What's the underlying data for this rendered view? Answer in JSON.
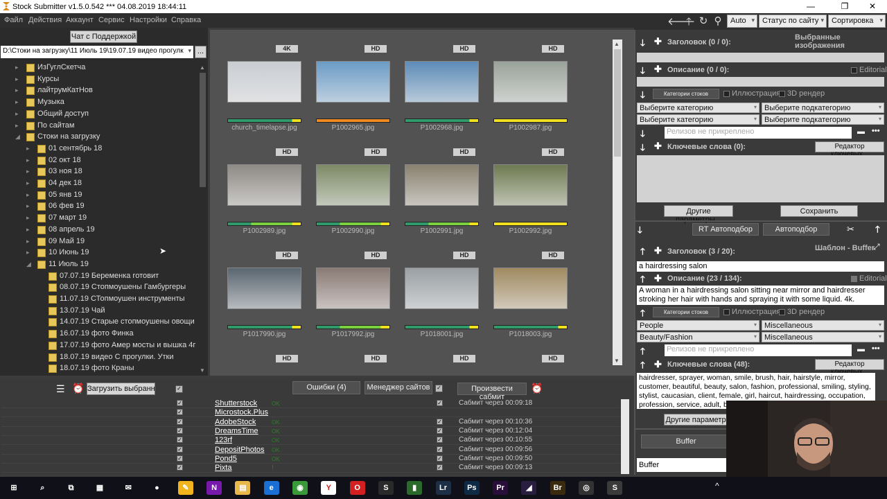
{
  "window": {
    "title": "Stock Submitter v1.5.0.542 ***  04.08.2019 18:44:11"
  },
  "menu": [
    "Файл",
    "Действия",
    "Аккаунт",
    "Сервис",
    "Настройки",
    "Справка"
  ],
  "toolbar": {
    "zoom": "Auto",
    "status_filter": "Статус по сайту",
    "sort": "Сортировка"
  },
  "left": {
    "support_button": "Чат с Поддержкой",
    "path": "D:\\Стоки на загрузку\\11 Июль 19\\19.07.19 видео прогулк",
    "browse_button": "...",
    "tree": [
      {
        "label": "ИзГуглСкетча",
        "level": 0,
        "exp": "▸"
      },
      {
        "label": "Курсы",
        "level": 0,
        "exp": "▸"
      },
      {
        "label": "лайтрумКатНов",
        "level": 0,
        "exp": "▸"
      },
      {
        "label": "Музыка",
        "level": 0,
        "exp": "▸"
      },
      {
        "label": "Общий доступ",
        "level": 0,
        "exp": "▸"
      },
      {
        "label": "По сайтам",
        "level": 0,
        "exp": "▸"
      },
      {
        "label": "Стоки на загрузку",
        "level": 0,
        "exp": "◢"
      },
      {
        "label": "01 сентябрь 18",
        "level": 1,
        "exp": "▸"
      },
      {
        "label": "02 окт 18",
        "level": 1,
        "exp": "▸"
      },
      {
        "label": "03 ноя 18",
        "level": 1,
        "exp": "▸"
      },
      {
        "label": "04 дек 18",
        "level": 1,
        "exp": "▸"
      },
      {
        "label": "05 янв 19",
        "level": 1,
        "exp": "▸"
      },
      {
        "label": "06 фев 19",
        "level": 1,
        "exp": "▸"
      },
      {
        "label": "07 март 19",
        "level": 1,
        "exp": "▸"
      },
      {
        "label": "08 апрель 19",
        "level": 1,
        "exp": "▸"
      },
      {
        "label": "09 Май 19",
        "level": 1,
        "exp": "▸"
      },
      {
        "label": "10 Июнь 19",
        "level": 1,
        "exp": "▸"
      },
      {
        "label": "11 Июль 19",
        "level": 1,
        "exp": "◢"
      },
      {
        "label": "07.07.19 Беременка готовит",
        "level": 2,
        "exp": ""
      },
      {
        "label": "08.07.19 Стопмоушены Гамбургеры",
        "level": 2,
        "exp": ""
      },
      {
        "label": "11.07.19 СТопмоушен инструменты",
        "level": 2,
        "exp": ""
      },
      {
        "label": "13.07.19 Чай",
        "level": 2,
        "exp": ""
      },
      {
        "label": "14.07.19 Старые стопмоушены овощи",
        "level": 2,
        "exp": ""
      },
      {
        "label": "16.07.19 фото Финка",
        "level": 2,
        "exp": ""
      },
      {
        "label": "17.07.19 фото Амер мосты и вышка 4г",
        "level": 2,
        "exp": ""
      },
      {
        "label": "18.07.19 видео С прогулки. Утки",
        "level": 2,
        "exp": ""
      },
      {
        "label": "18.07.19 фото Краны",
        "level": 2,
        "exp": ""
      }
    ]
  },
  "grid": {
    "items": [
      {
        "badge": "4K",
        "name": "church_timelapse.jpg",
        "bar": "gy",
        "img": "#c9cdd2"
      },
      {
        "badge": "HD",
        "name": "P1002965.jpg",
        "bar": "o",
        "img": "#6b9cc6"
      },
      {
        "badge": "HD",
        "name": "P1002968.jpg",
        "bar": "gy",
        "img": "#5d8cb8"
      },
      {
        "badge": "HD",
        "name": "P1002987.jpg",
        "bar": "y",
        "img": "#9aa39a"
      },
      {
        "badge": "HD",
        "name": "P1002989.jpg",
        "bar": "gly",
        "img": "#8e8a84"
      },
      {
        "badge": "HD",
        "name": "P1002990.jpg",
        "bar": "gly",
        "img": "#7c8a66"
      },
      {
        "badge": "HD",
        "name": "P1002991.jpg",
        "bar": "gly",
        "img": "#8a8270"
      },
      {
        "badge": "HD",
        "name": "P1002992.jpg",
        "bar": "y",
        "img": "#6e7a50"
      },
      {
        "badge": "HD",
        "name": "P1017990.jpg",
        "bar": "gy",
        "img": "#5a6670"
      },
      {
        "badge": "HD",
        "name": "P1017992.jpg",
        "bar": "gly",
        "img": "#8a7a74"
      },
      {
        "badge": "HD",
        "name": "P1018001.jpg",
        "bar": "gy",
        "img": "#9aa0a4"
      },
      {
        "badge": "HD",
        "name": "P1018003.jpg",
        "bar": "gy",
        "img": "#a08a60"
      },
      {
        "badge": "HD",
        "name": "",
        "bar": "",
        "img": ""
      },
      {
        "badge": "HD",
        "name": "",
        "bar": "",
        "img": ""
      },
      {
        "badge": "HD",
        "name": "",
        "bar": "",
        "img": ""
      },
      {
        "badge": "HD",
        "name": "",
        "bar": "",
        "img": ""
      }
    ]
  },
  "selected": {
    "header": "Выбранные изображения",
    "title_label": "Заголовок (0 / 0):",
    "desc_label": "Описание (0 / 0):",
    "editorial": "Editorial",
    "categories_btn": "Категории стоков",
    "illustration": "Иллюстрация",
    "render3d": "3D рендер",
    "cat1": "Выберите категорию",
    "subcat1": "Выберите подкатегорию",
    "cat2": "Выберите категорию",
    "subcat2": "Выберите подкатегорию",
    "release_placeholder": "Релизов не прикреплено",
    "keywords_label": "Ключевые слова (0):",
    "kw_editor": "Редактор ключевых...",
    "other_params": "Другие параметры...",
    "save": "Сохранить",
    "rt_auto": "RT Автоподбор",
    "auto": "Автоподбор"
  },
  "template": {
    "title_label": "Заголовок (3 / 20):",
    "template_name": "Шаблон - Buffer",
    "title_value": "a hairdressing salon",
    "desc_label": "Описание (23 / 134):",
    "editorial": "Editorial",
    "desc_value": "A woman in a hairdressing salon sitting near mirror and hairdresser stroking her hair with hands and spraying it with some liquid. 4k.",
    "categories_btn": "Категории стоков",
    "illustration": "Иллюстрация",
    "render3d": "3D рендер",
    "cat1": "People",
    "subcat1": "Miscellaneous",
    "cat2": "Beauty/Fashion",
    "subcat2": "Miscellaneous",
    "release_placeholder": "Релизов не прикреплено",
    "keywords_label": "Ключевые слова (48):",
    "kw_editor": "Редактор ключевых...",
    "keywords": "hairdresser, sprayer, woman, smile, brush, hair, hairstyle, mirror, customer, beautiful, beauty, salon, fashion, professional, smiling, styling, stylist, caucasian, client, female, girl, haircut, hairdressing, occupation, profession, service, adult, barber, care, fashionable, hairstylist, head, people, pretty,",
    "other_params": "Другие параметры",
    "buffer_btn": "Buffer",
    "buffer_value": "Buffer"
  },
  "bottom": {
    "upload_selected": "Загрузить выбранное",
    "errors": "Ошибки (4)",
    "site_manager": "Менеджер сайтов",
    "submit": "Произвести сабмит",
    "sites": [
      {
        "name": "Shutterstock",
        "ok": "OK",
        "status": "Сабмит через 00:09:18"
      },
      {
        "name": "Microstock.Plus",
        "ok": "",
        "status": ""
      },
      {
        "name": "AdobeStock",
        "ok": "OK",
        "status": "Сабмит через 00:10:36"
      },
      {
        "name": "DreamsTime",
        "ok": "OK",
        "status": "Сабмит через 00:12:04"
      },
      {
        "name": "123rf",
        "ok": "OK",
        "status": "Сабмит через 00:10:55"
      },
      {
        "name": "DepositPhotos",
        "ok": "OK",
        "status": "Сабмит через 00:09:56"
      },
      {
        "name": "Pond5",
        "ok": "OK",
        "status": "Сабмит через 00:09:50"
      },
      {
        "name": "Pixta",
        "ok": "!",
        "status": "Сабмит через 00:09:13"
      }
    ]
  },
  "taskbar": {
    "apps": [
      {
        "name": "windows-start",
        "label": "⊞",
        "color": "#101018"
      },
      {
        "name": "search",
        "label": "⌕",
        "color": "#101018"
      },
      {
        "name": "task-view",
        "label": "⧉",
        "color": "#101018"
      },
      {
        "name": "calendar",
        "label": "▦",
        "color": "#101018"
      },
      {
        "name": "mail",
        "label": "✉",
        "color": "#101018"
      },
      {
        "name": "recorder",
        "label": "●",
        "color": "#101018"
      },
      {
        "name": "notes",
        "label": "✎",
        "color": "#f1b41c"
      },
      {
        "name": "onenote",
        "label": "N",
        "color": "#7719aa"
      },
      {
        "name": "explorer",
        "label": "▤",
        "color": "#e8b84a"
      },
      {
        "name": "edge",
        "label": "e",
        "color": "#1a6fd4"
      },
      {
        "name": "chrome",
        "label": "◉",
        "color": "#3a9a3a"
      },
      {
        "name": "yandex",
        "label": "Y",
        "color": "#fff"
      },
      {
        "name": "opera",
        "label": "O",
        "color": "#d21f1f"
      },
      {
        "name": "stocksubmitter",
        "label": "S",
        "color": "#2a2a2a"
      },
      {
        "name": "charts",
        "label": "▮",
        "color": "#2a6a2a"
      },
      {
        "name": "lightroom",
        "label": "Lr",
        "color": "#1d2f46"
      },
      {
        "name": "photoshop",
        "label": "Ps",
        "color": "#0e2a45"
      },
      {
        "name": "premiere",
        "label": "Pr",
        "color": "#2a0e3a"
      },
      {
        "name": "media-encoder",
        "label": "◢",
        "color": "#2a1e40"
      },
      {
        "name": "bridge",
        "label": "Br",
        "color": "#3a2a0e"
      },
      {
        "name": "davinci",
        "label": "◎",
        "color": "#333"
      },
      {
        "name": "stocksubmitter-active",
        "label": "S",
        "color": "#3a3a3a"
      }
    ]
  }
}
